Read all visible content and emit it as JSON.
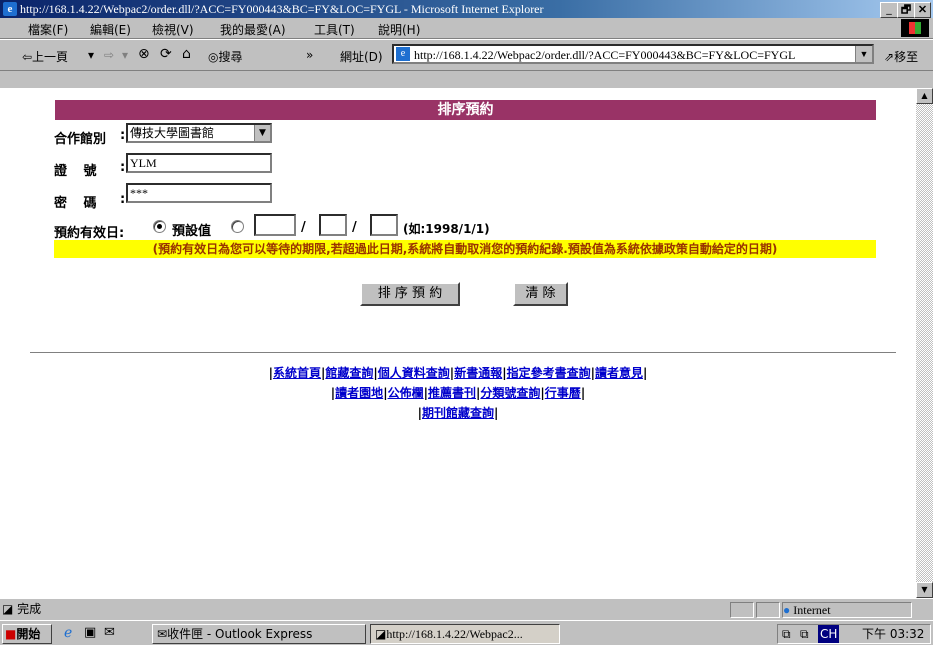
{
  "window": {
    "title": "http://168.1.4.22/Webpac2/order.dll/?ACC=FY000443&BC=FY&LOC=FYGL - Microsoft Internet Explorer",
    "min": "_",
    "max": "🗗",
    "close": "✕"
  },
  "menu": [
    "檔案(F)",
    "編輯(E)",
    "檢視(V)",
    "我的最愛(A)",
    "工具(T)",
    "說明(H)"
  ],
  "toolbar": {
    "back": "⇦上一頁",
    "back_dd": "▾",
    "forward": "⇨",
    "forward_dd": "▾",
    "stop": "⊗",
    "refresh": "⟳",
    "home": "⌂",
    "search": "搜尋",
    "more": "»",
    "address_label": "網址(D)",
    "address_value": "http://168.1.4.22/Webpac2/order.dll/?ACC=FY000443&BC=FY&LOC=FYGL",
    "go": "移至"
  },
  "page": {
    "banner": "排序預約",
    "library_label": "合作館別",
    "library_value": "傳技大學圖書館",
    "id_label": "證  號",
    "id_value": "YLM",
    "pw_label": "密  碼",
    "pw_value": "***",
    "expiry_label": "預約有效日:",
    "default_label": "預設值",
    "slash": "/",
    "date_example": "(如:1998/1/1)",
    "note": "(預約有效日為您可以等待的期限,若超過此日期,系統將自動取消您的預約紀錄.預設值為系統依據政策自動給定的日期)",
    "submit": "排 序 預 約",
    "clear": "清 除"
  },
  "links": {
    "row1": [
      "系統首頁",
      "館藏查詢",
      "個人資料查詢",
      "新書通報",
      "指定參考書查詢",
      "讀者意見"
    ],
    "row2": [
      "讀者園地",
      "公佈欄",
      "推薦書刊",
      "分類號查詢",
      "行事曆"
    ],
    "row3": [
      "期刊館藏查詢"
    ]
  },
  "status": {
    "text": "完成",
    "zone": "Internet"
  },
  "taskbar": {
    "start": "開始",
    "outlook": "收件匣 - Outlook Express",
    "ie": "http://168.1.4.22/Webpac2...",
    "ime": "CH",
    "clock": "下午 03:32"
  }
}
